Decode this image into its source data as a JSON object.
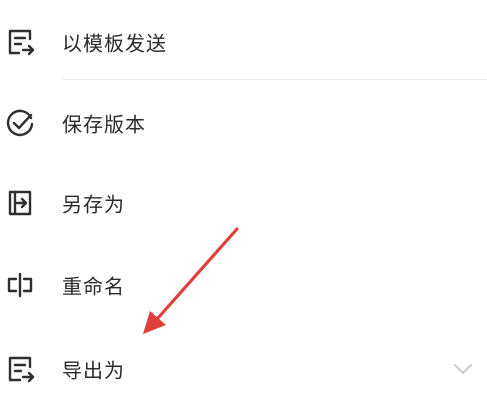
{
  "menu": {
    "items": [
      {
        "label": "以模板发送",
        "icon": "template-send-icon"
      },
      {
        "label": "保存版本",
        "icon": "check-circle-icon"
      },
      {
        "label": "另存为",
        "icon": "save-as-icon"
      },
      {
        "label": "重命名",
        "icon": "rename-icon"
      },
      {
        "label": "导出为",
        "icon": "export-icon"
      }
    ]
  },
  "colors": {
    "icon": "#2f2f2f",
    "text": "#2b2b2b",
    "divider": "#ececec",
    "chevron": "#c8c8c8",
    "annotation_arrow": "#e0403a"
  }
}
